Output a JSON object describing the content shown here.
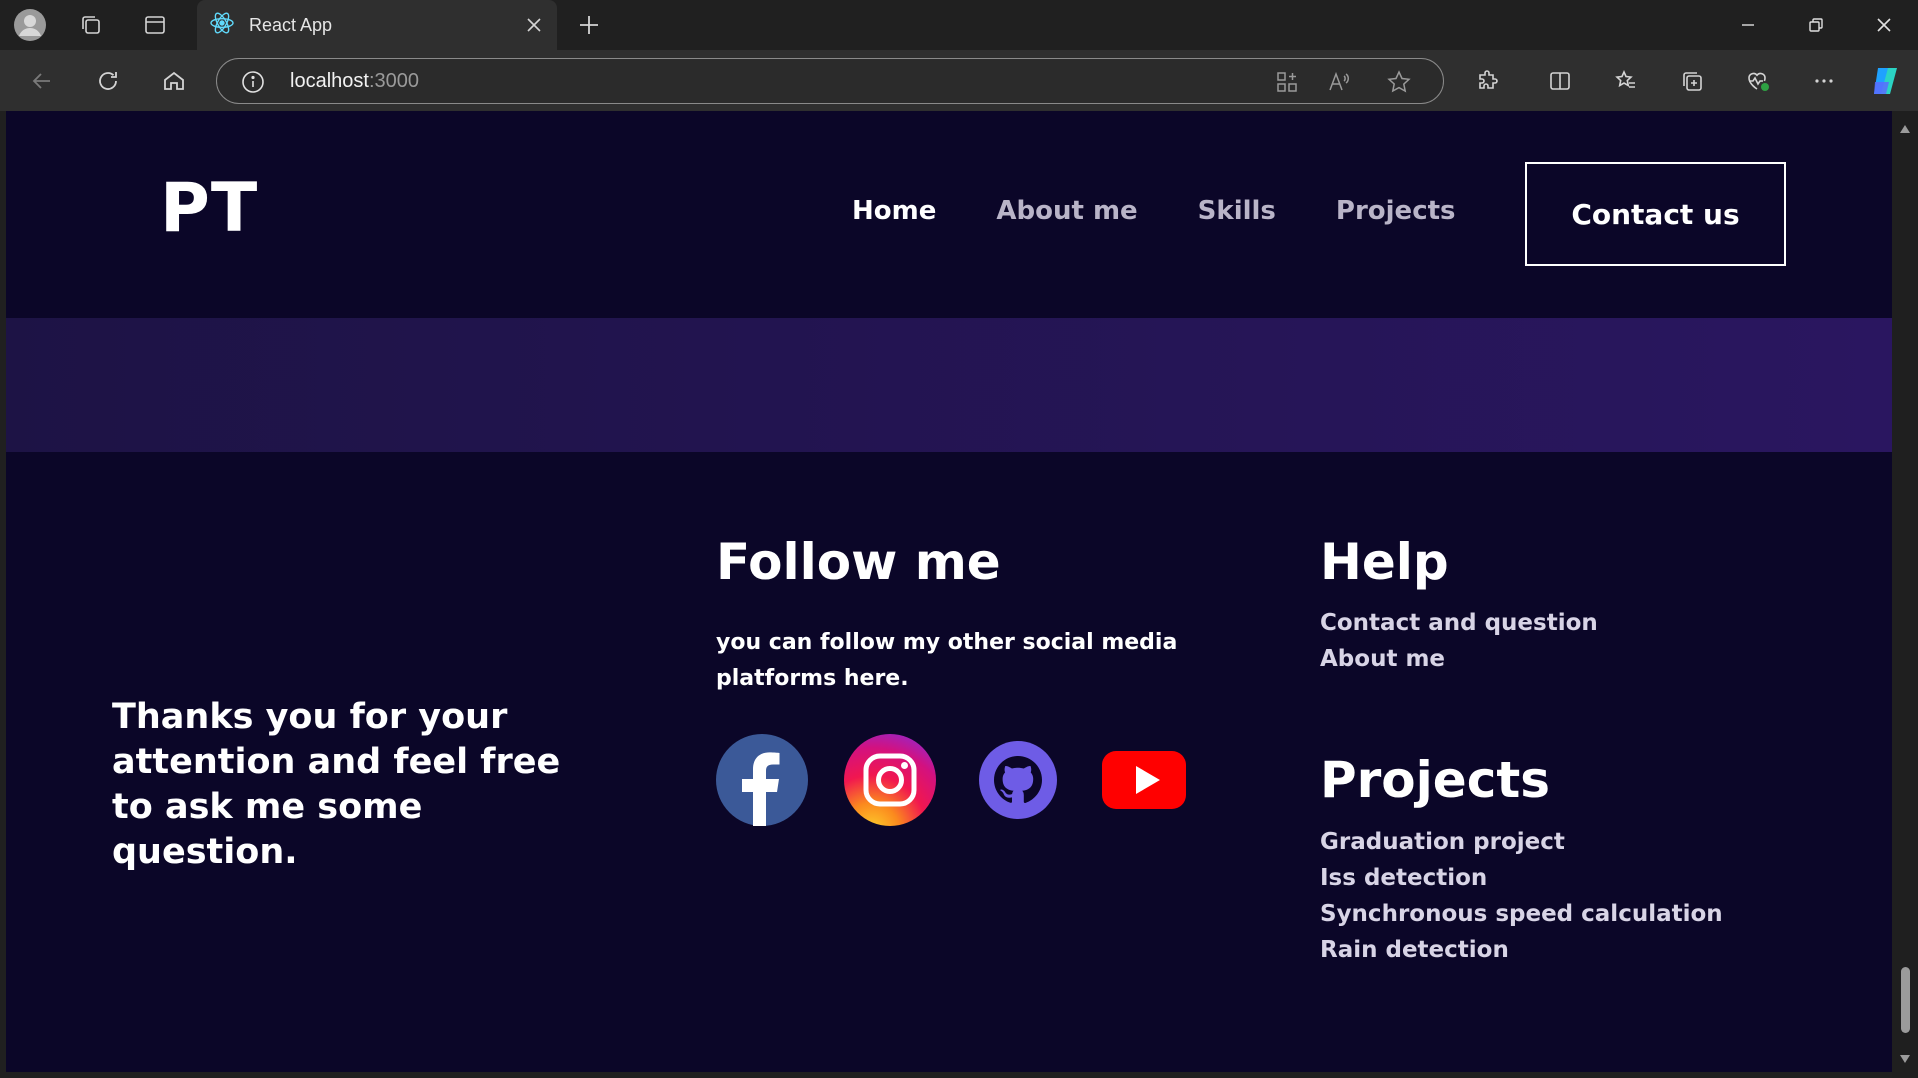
{
  "browser": {
    "tab_title": "React App",
    "address_host": "localhost",
    "address_port": ":3000"
  },
  "nav": {
    "logo": "PT",
    "links": [
      "Home",
      "About me",
      "Skills",
      "Projects"
    ],
    "contact_label": "Contact us"
  },
  "footer": {
    "thanks_text": "Thanks you for your attention and feel free to ask me some question.",
    "follow": {
      "title": "Follow me",
      "description": "you can follow my other social media platforms here.",
      "icons": [
        "facebook-icon",
        "instagram-icon",
        "github-icon",
        "youtube-icon"
      ]
    },
    "help": {
      "title": "Help",
      "links": [
        "Contact and question",
        "About me"
      ]
    },
    "projects": {
      "title": "Projects",
      "links": [
        "Graduation project",
        "Iss detection",
        "Synchronous speed calculation",
        "Rain detection"
      ]
    }
  },
  "colors": {
    "page_background": "#0b0628",
    "band_start": "#1d1345",
    "band_end": "#2a1660",
    "facebook": "#3b5998",
    "github": "#6e5ce6",
    "youtube": "#ff0000"
  }
}
